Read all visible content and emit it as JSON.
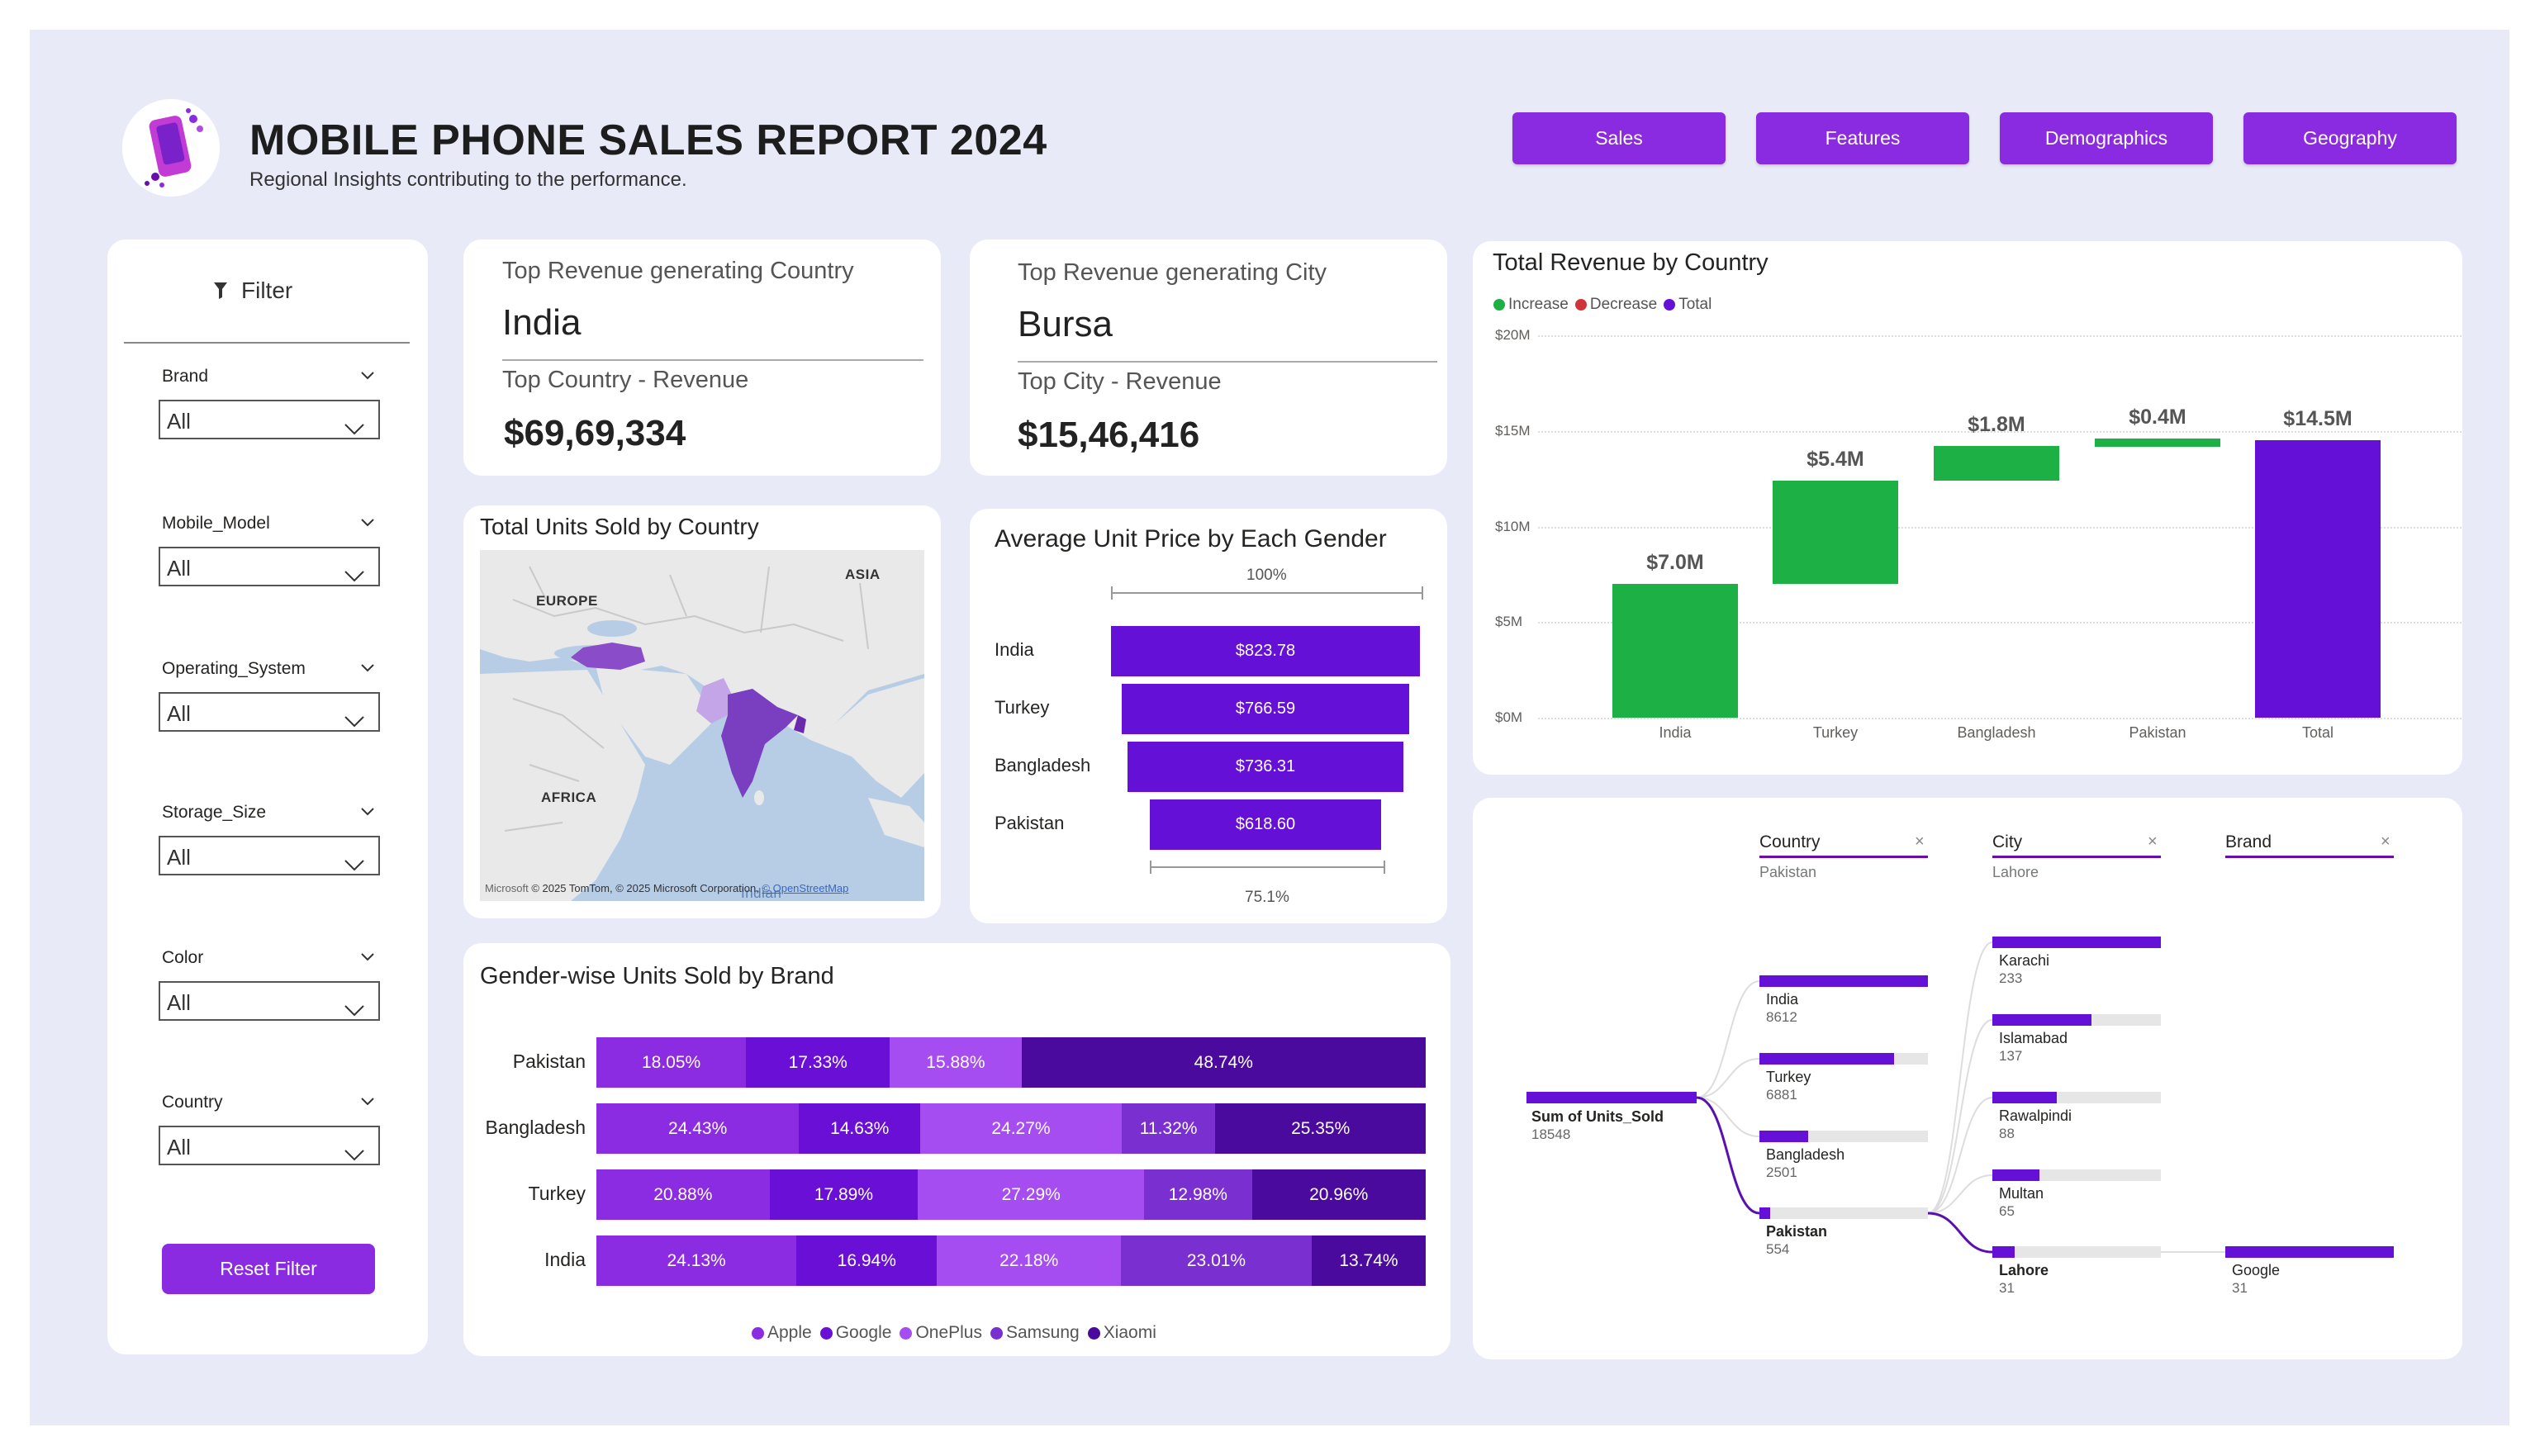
{
  "header": {
    "title": "MOBILE PHONE SALES REPORT 2024",
    "subtitle": "Regional Insights contributing to the performance."
  },
  "nav": {
    "sales": "Sales",
    "features": "Features",
    "demographics": "Demographics",
    "geography": "Geography"
  },
  "filters": {
    "title": "Filter",
    "slicers": [
      {
        "label": "Brand",
        "value": "All"
      },
      {
        "label": "Mobile_Model",
        "value": "All"
      },
      {
        "label": "Operating_System",
        "value": "All"
      },
      {
        "label": "Storage_Size",
        "value": "All"
      },
      {
        "label": "Color",
        "value": "All"
      },
      {
        "label": "Country",
        "value": "All"
      }
    ],
    "reset": "Reset Filter"
  },
  "kpi": {
    "country": {
      "label": "Top Revenue generating Country",
      "value": "India",
      "rev_label": "Top Country - Revenue",
      "rev_value": "$69,69,334"
    },
    "city": {
      "label": "Top Revenue generating City",
      "value": "Bursa",
      "rev_label": "Top City - Revenue",
      "rev_value": "$15,46,416"
    }
  },
  "map": {
    "title": "Total Units Sold by Country",
    "labels": {
      "europe": "EUROPE",
      "asia": "ASIA",
      "africa": "AFRICA",
      "indian": "Indian"
    },
    "attribution_brand": "Microsoft",
    "attribution": "© 2025 TomTom, © 2025 Microsoft Corporation,",
    "attribution_link": "© OpenStreetMap",
    "colors": {
      "highlight": "#7a3fc0",
      "land": "#e9e9e9",
      "water": "#b7cde6"
    }
  },
  "funnel": {
    "title": "Average Unit Price by Each Gender",
    "top_pct": "100%",
    "bottom_pct": "75.1%",
    "chart_data": {
      "type": "bar",
      "categories": [
        "India",
        "Turkey",
        "Bangladesh",
        "Pakistan"
      ],
      "values": [
        823.78,
        766.59,
        736.31,
        618.6
      ],
      "labels": [
        "$823.78",
        "$766.59",
        "$736.31",
        "$618.60"
      ]
    }
  },
  "stacked": {
    "title": "Gender-wise Units Sold by Brand",
    "chart_data": {
      "type": "bar",
      "categories": [
        "Pakistan",
        "Bangladesh",
        "Turkey",
        "India"
      ],
      "series": [
        {
          "name": "Apple",
          "color": "#8b2be2",
          "values": [
            18.05,
            24.43,
            20.88,
            24.13
          ]
        },
        {
          "name": "Google",
          "color": "#6a0fd6",
          "values": [
            17.33,
            14.63,
            17.89,
            16.94
          ]
        },
        {
          "name": "OnePlus",
          "color": "#a64df2",
          "values": [
            15.88,
            24.27,
            27.29,
            22.18
          ]
        },
        {
          "name": "Samsung",
          "color": "#7a2fd0",
          "values": [
            0,
            11.32,
            12.98,
            23.01
          ]
        },
        {
          "name": "Xiaomi",
          "color": "#4b0a9e",
          "values": [
            48.74,
            25.35,
            20.96,
            13.74
          ]
        }
      ],
      "labels": [
        [
          "18.05%",
          "17.33%",
          "15.88%",
          "",
          "48.74%"
        ],
        [
          "24.43%",
          "14.63%",
          "24.27%",
          "11.32%",
          "25.35%"
        ],
        [
          "20.88%",
          "17.89%",
          "27.29%",
          "12.98%",
          "20.96%"
        ],
        [
          "24.13%",
          "16.94%",
          "22.18%",
          "23.01%",
          "13.74%"
        ]
      ]
    }
  },
  "waterfall": {
    "title": "Total Revenue by Country",
    "legend": [
      {
        "name": "Increase",
        "color": "#1db045"
      },
      {
        "name": "Decrease",
        "color": "#d13438"
      },
      {
        "name": "Total",
        "color": "#6510d6"
      }
    ],
    "yticks": [
      "$20M",
      "$15M",
      "$10M",
      "$5M",
      "$0M"
    ],
    "chart_data": {
      "type": "bar",
      "categories": [
        "India",
        "Turkey",
        "Bangladesh",
        "Pakistan",
        "Total"
      ],
      "values": [
        7.0,
        5.4,
        1.8,
        0.4,
        14.5
      ],
      "labels": [
        "$7.0M",
        "$5.4M",
        "$1.8M",
        "$0.4M",
        "$14.5M"
      ],
      "ylim": [
        0,
        20
      ]
    }
  },
  "decomp": {
    "root": {
      "label": "Sum of Units_Sold",
      "value": "18548"
    },
    "columns": [
      {
        "head": "Country",
        "sub": "Pakistan"
      },
      {
        "head": "City",
        "sub": "Lahore"
      },
      {
        "head": "Brand",
        "sub": ""
      }
    ],
    "countries": [
      {
        "name": "India",
        "value": "8612",
        "fill": 1.0
      },
      {
        "name": "Turkey",
        "value": "6881",
        "fill": 0.8
      },
      {
        "name": "Bangladesh",
        "value": "2501",
        "fill": 0.29
      },
      {
        "name": "Pakistan",
        "value": "554",
        "fill": 0.064
      }
    ],
    "cities": [
      {
        "name": "Karachi",
        "value": "233",
        "fill": 1.0
      },
      {
        "name": "Islamabad",
        "value": "137",
        "fill": 0.59
      },
      {
        "name": "Rawalpindi",
        "value": "88",
        "fill": 0.38
      },
      {
        "name": "Multan",
        "value": "65",
        "fill": 0.28
      },
      {
        "name": "Lahore",
        "value": "31",
        "fill": 0.13
      }
    ],
    "brands": [
      {
        "name": "Google",
        "value": "31",
        "fill": 1.0
      }
    ]
  }
}
